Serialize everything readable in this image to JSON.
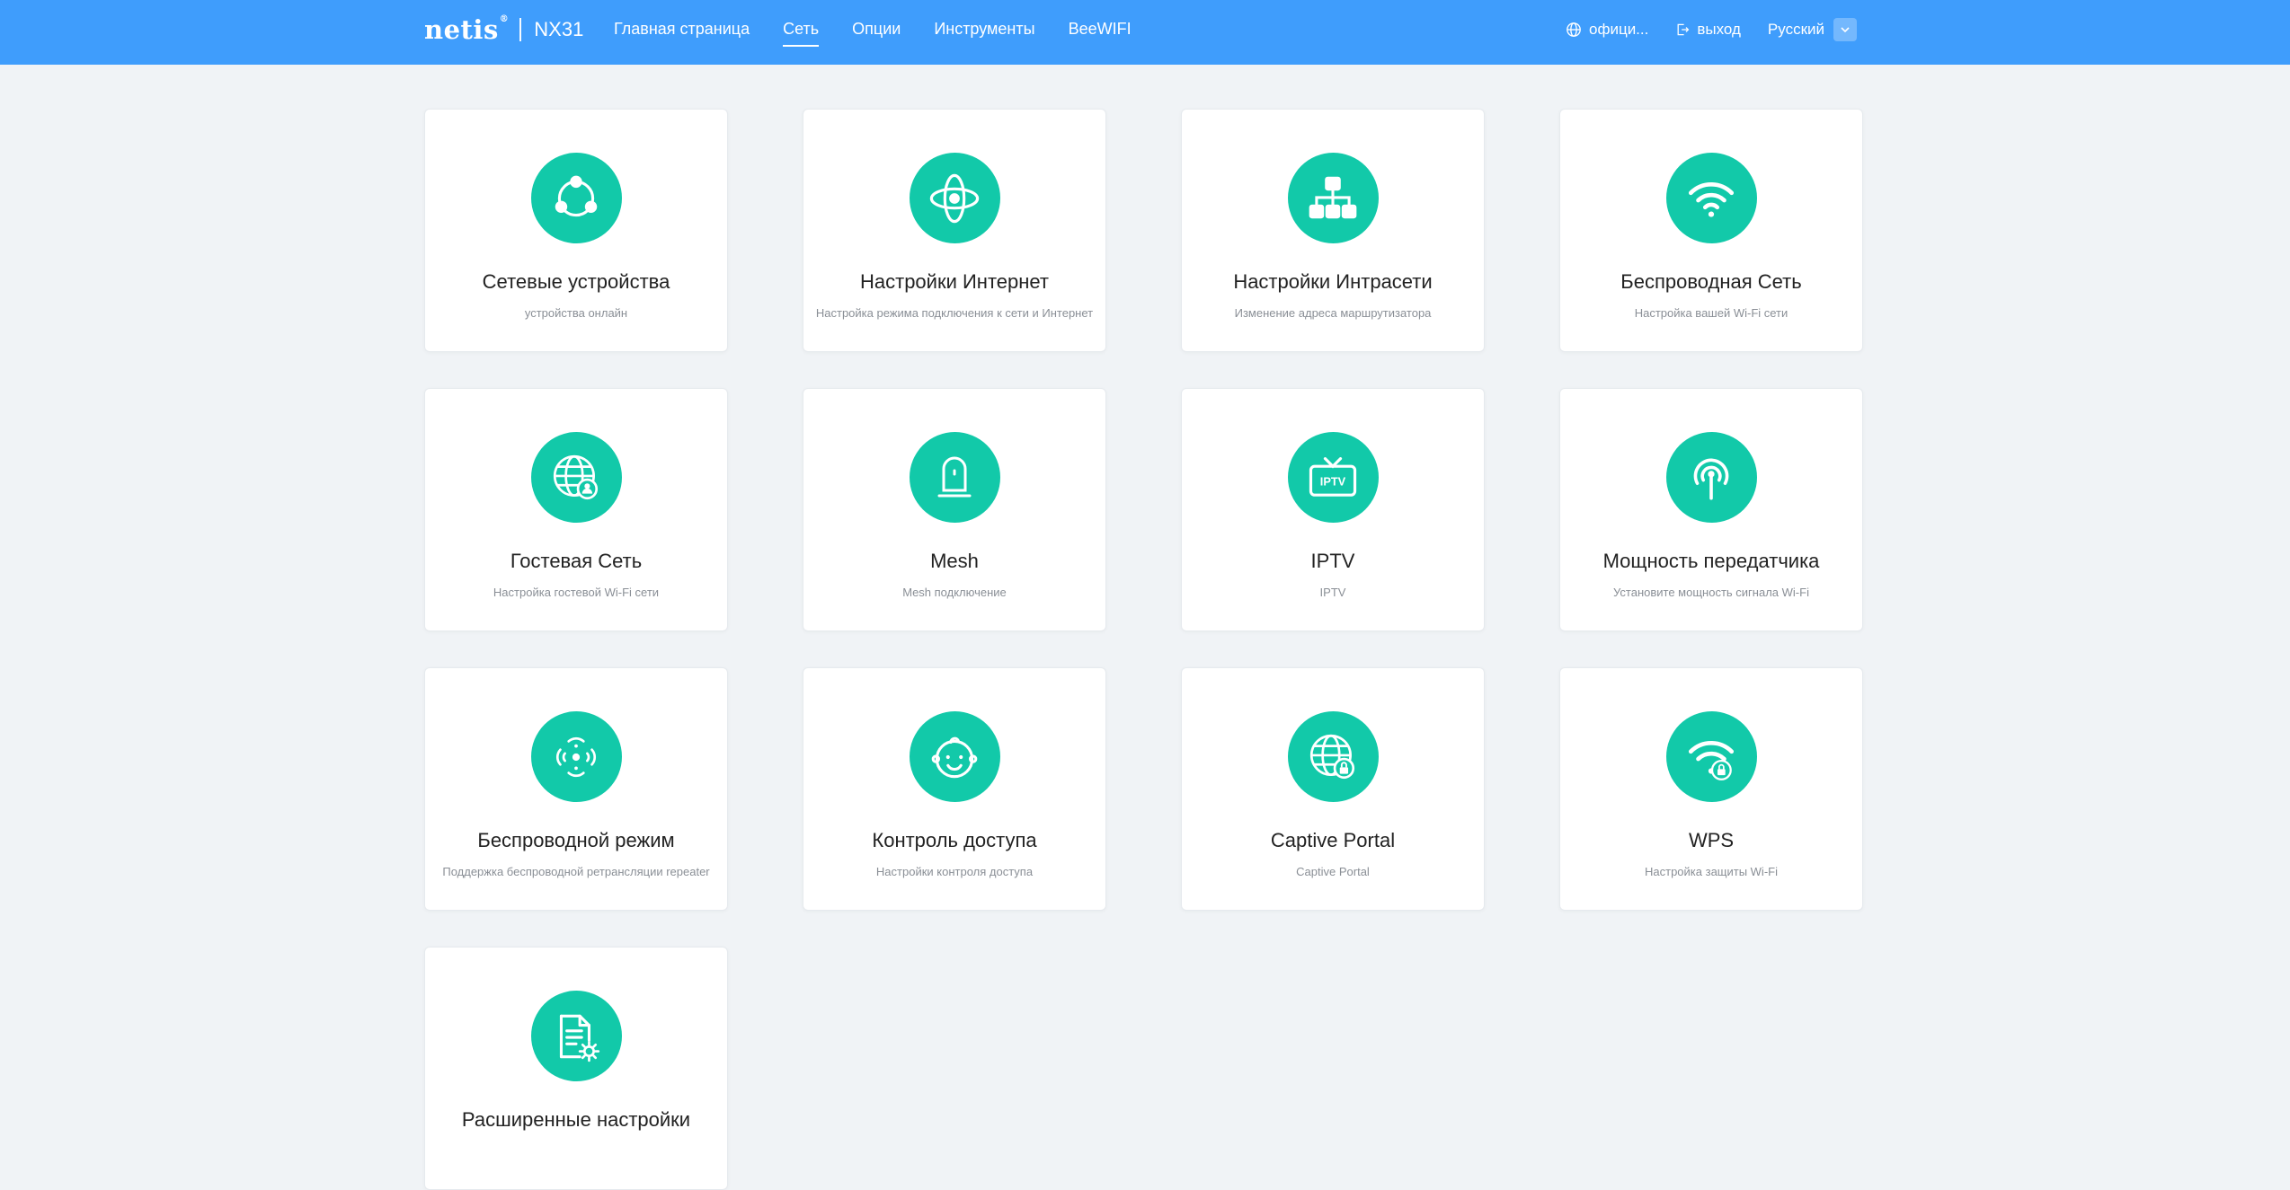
{
  "header": {
    "logo": "netis",
    "logo_mark": "®",
    "model": "NX31",
    "nav": [
      {
        "label": "Главная страница",
        "active": false
      },
      {
        "label": "Сеть",
        "active": true
      },
      {
        "label": "Опции",
        "active": false
      },
      {
        "label": "Инструменты",
        "active": false
      },
      {
        "label": "BeeWIFI",
        "active": false
      }
    ],
    "official_label": "офици...",
    "logout_label": "выход",
    "language": "Русский"
  },
  "colors": {
    "header_bg": "#3f9dfc",
    "accent": "#12c9a9",
    "page_bg": "#f0f3f6"
  },
  "cards": [
    {
      "title": "Сетевые устройства",
      "subtitle": "устройства онлайн",
      "icon": "network-devices-icon"
    },
    {
      "title": "Настройки Интернет",
      "subtitle": "Настройка режима подключения к сети и Интернет",
      "icon": "internet-icon"
    },
    {
      "title": "Настройки Интрасети",
      "subtitle": "Изменение адреса маршрутизатора",
      "icon": "lan-topology-icon"
    },
    {
      "title": "Беспроводная Сеть",
      "subtitle": "Настройка вашей Wi-Fi сети",
      "icon": "wifi-icon"
    },
    {
      "title": "Гостевая Сеть",
      "subtitle": "Настройка гостевой Wi-Fi сети",
      "icon": "guest-globe-icon"
    },
    {
      "title": "Mesh",
      "subtitle": "Mesh подключение",
      "icon": "mesh-device-icon"
    },
    {
      "title": "IPTV",
      "subtitle": "IPTV",
      "icon": "iptv-icon",
      "icon_text": "IPTV"
    },
    {
      "title": "Мощность передатчика",
      "subtitle": "Установите мощность сигнала Wi-Fi",
      "icon": "antenna-icon"
    },
    {
      "title": "Беспроводной режим",
      "subtitle": "Поддержка беспроводной ретрансляции repeater",
      "icon": "wireless-mode-icon"
    },
    {
      "title": "Контроль доступа",
      "subtitle": "Настройки контроля доступа",
      "icon": "child-face-icon"
    },
    {
      "title": "Captive Portal",
      "subtitle": "Captive Portal",
      "icon": "captive-portal-icon"
    },
    {
      "title": "WPS",
      "subtitle": "Настройка защиты Wi-Fi",
      "icon": "wps-lock-icon"
    },
    {
      "title": "Расширенные настройки",
      "subtitle": "",
      "icon": "advanced-settings-icon"
    }
  ]
}
